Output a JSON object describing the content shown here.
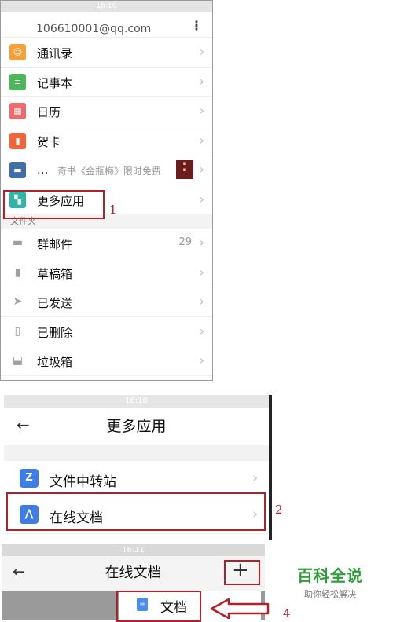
{
  "panel1": {
    "status_time": "16:10",
    "account_email": "106610001@qq.com",
    "apps": [
      {
        "label": "通讯录",
        "icon": "contacts-icon",
        "color": "#f5a03a"
      },
      {
        "label": "记事本",
        "icon": "notepad-icon",
        "color": "#4cb85c"
      },
      {
        "label": "日历",
        "icon": "calendar-icon",
        "color": "#ef6a6a"
      },
      {
        "label": "贺卡",
        "icon": "greeting-card-icon",
        "color": "#f0643a"
      },
      {
        "label": "...",
        "icon": "reader-icon",
        "color": "#3f6ea8",
        "promo": "奇书《金瓶梅》限时免费"
      },
      {
        "label": "更多应用",
        "icon": "grid-icon",
        "color": "#2fb5a8"
      }
    ],
    "section_label": "文件夹",
    "folders": [
      {
        "label": "群邮件",
        "icon": "folder-icon",
        "count": "29"
      },
      {
        "label": "草稿箱",
        "icon": "draft-icon"
      },
      {
        "label": "已发送",
        "icon": "send-icon"
      },
      {
        "label": "已删除",
        "icon": "trash-icon"
      },
      {
        "label": "垃圾箱",
        "icon": "spam-icon"
      }
    ],
    "step": "1"
  },
  "panel2": {
    "status_time": "16:10",
    "title": "更多应用",
    "items": [
      {
        "label": "文件中转站",
        "icon": "transfer-icon"
      },
      {
        "label": "在线文档",
        "icon": "online-doc-icon"
      }
    ],
    "step": "2"
  },
  "panel3": {
    "status_time": "16:11",
    "title": "在线文档",
    "plus": "+",
    "menu_item": "文档",
    "step": "4"
  },
  "watermark": {
    "title": "百科全说",
    "subtitle": "助你轻松解决"
  },
  "colors": {
    "annotation_red": "#b2202b",
    "watermark_green": "#2f9c3a"
  }
}
